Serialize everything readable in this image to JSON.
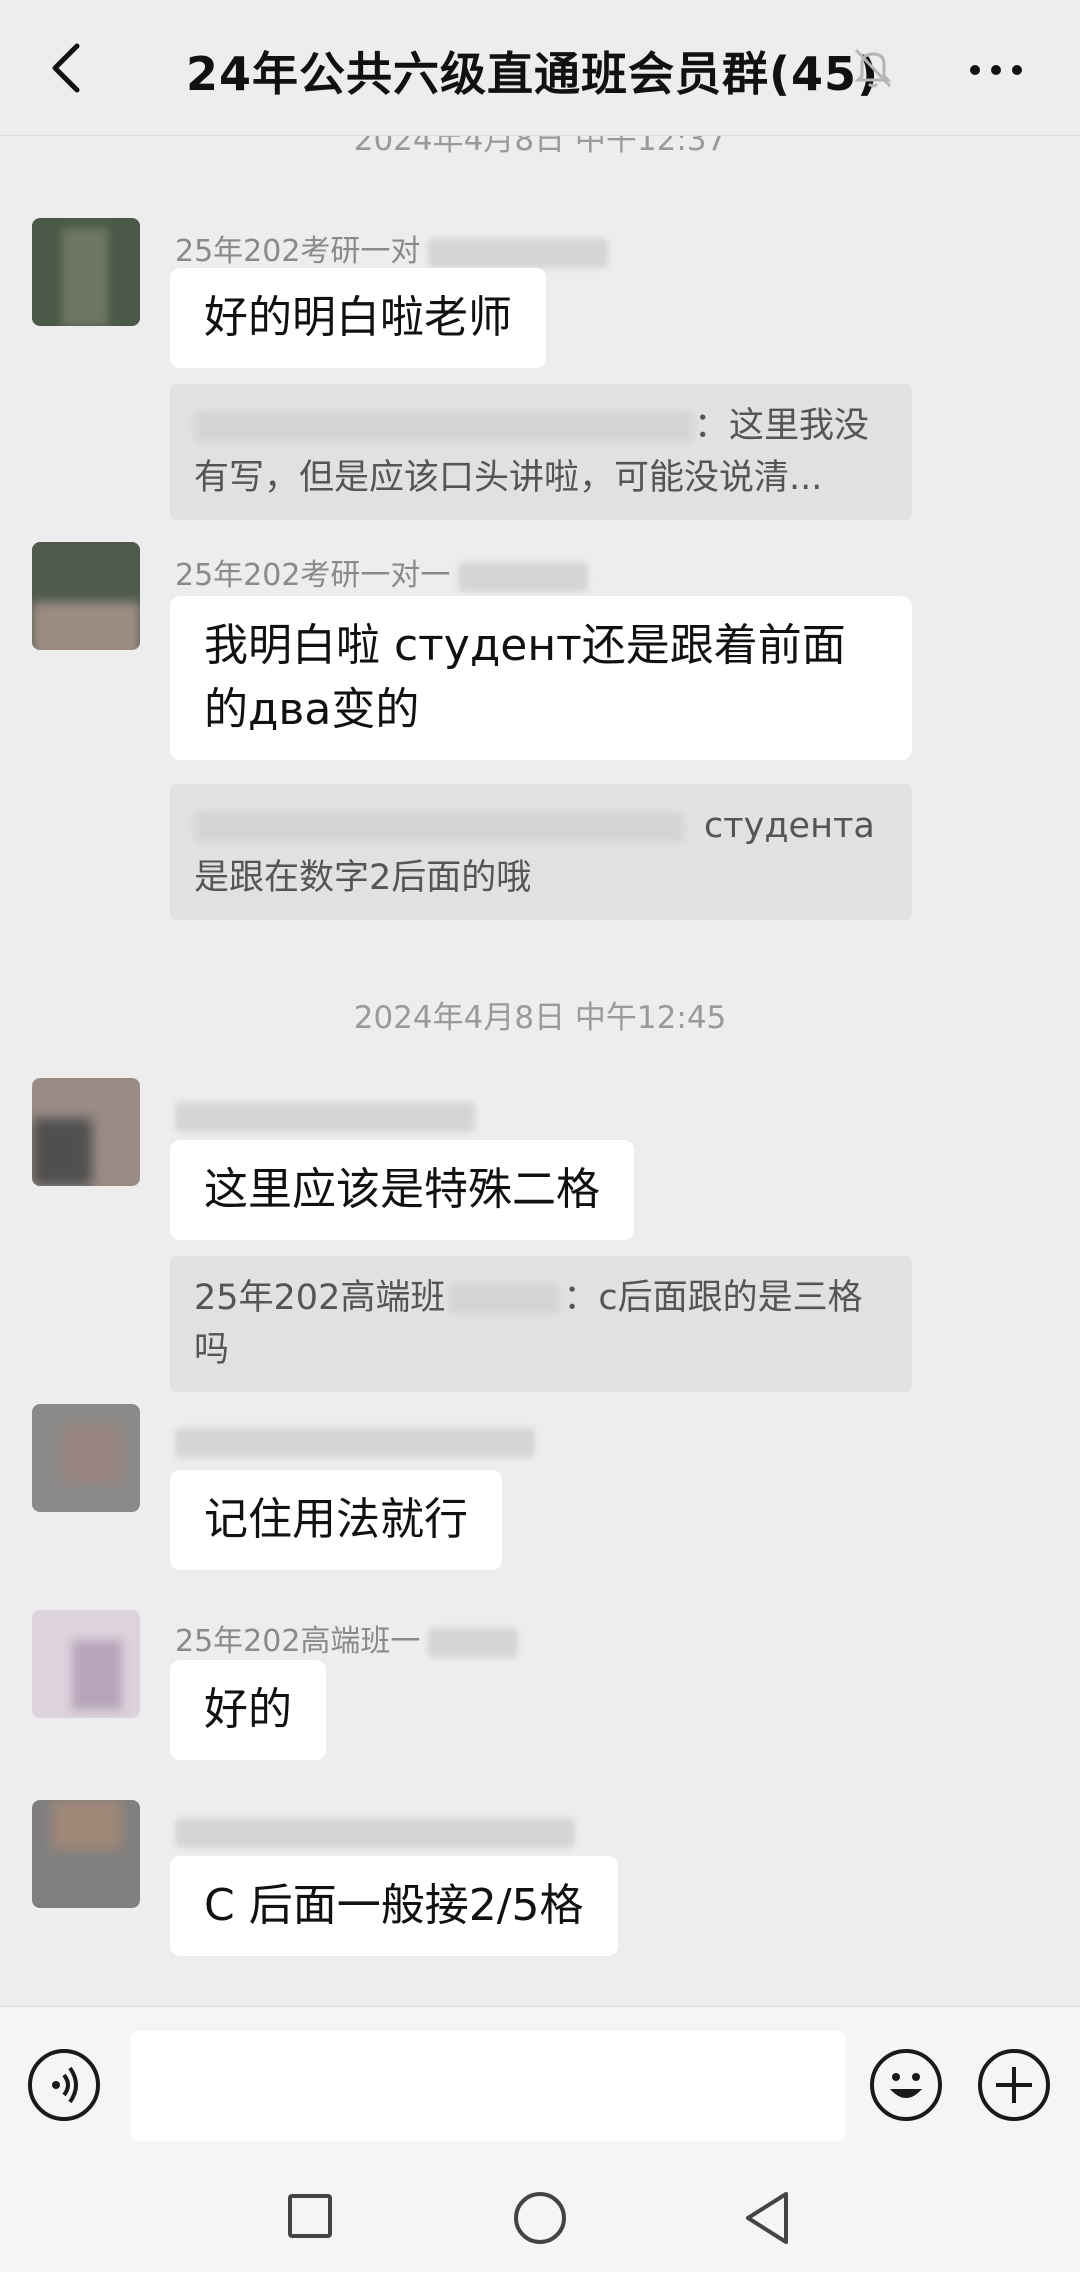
{
  "header": {
    "title": "24年公共六级直通班会员群(45)"
  },
  "chat": {
    "top_timestamp_partial": "2024年4月8日 中午12:37",
    "mid_timestamp": "2024年4月8日 中午12:45",
    "messages": [
      {
        "sender": "25年202考研一对",
        "text": "好的明白啦老师",
        "quote": [
          "：这里我没",
          "有写，但是应该口头讲啦，可能没说清..."
        ]
      },
      {
        "sender": "25年202考研一对一",
        "text_lines": [
          "我明白啦 студент还是跟着前面",
          "的два变的"
        ],
        "quote": [
          "студента",
          "是跟在数字2后面的哦"
        ]
      },
      {
        "sender": "",
        "text": "这里应该是特殊二格",
        "quote": [
          "25年202高端班",
          "：c后面跟的是三格",
          "吗"
        ]
      },
      {
        "sender": "",
        "text": "记住用法就行"
      },
      {
        "sender": "25年202高端班一",
        "text": "好的"
      },
      {
        "sender": "",
        "text": "C 后面一般接2/5格"
      }
    ]
  },
  "input": {
    "placeholder": ""
  },
  "colors": {
    "background": "#ededed",
    "bubble": "#ffffff",
    "quote": "#e1e1e1"
  }
}
